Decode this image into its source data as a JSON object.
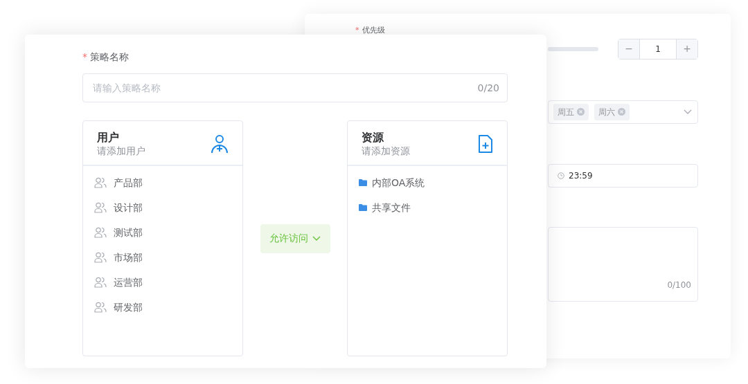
{
  "back_form": {
    "priority": {
      "required_mark": "*",
      "label": "优先级",
      "decrement": "−",
      "value": "1",
      "increment": "+"
    },
    "days": {
      "tags": [
        {
          "label": "周五"
        },
        {
          "label": "周六"
        }
      ]
    },
    "time": {
      "value": "23:59"
    },
    "note": {
      "counter": "0/100"
    }
  },
  "strategy_form": {
    "name_field": {
      "required_mark": "*",
      "label": "策略名称",
      "placeholder": "请输入策略名称",
      "counter": "0/20"
    },
    "users": {
      "title": "用户",
      "subtitle": "请添加用户",
      "items": [
        {
          "label": "产品部"
        },
        {
          "label": "设计部"
        },
        {
          "label": "测试部"
        },
        {
          "label": "市场部"
        },
        {
          "label": "运营部"
        },
        {
          "label": "研发部"
        }
      ]
    },
    "action": {
      "label": "允许访问"
    },
    "resources": {
      "title": "资源",
      "subtitle": "请添加资源",
      "items": [
        {
          "label": "内部OA系统"
        },
        {
          "label": "共享文件"
        }
      ]
    }
  }
}
